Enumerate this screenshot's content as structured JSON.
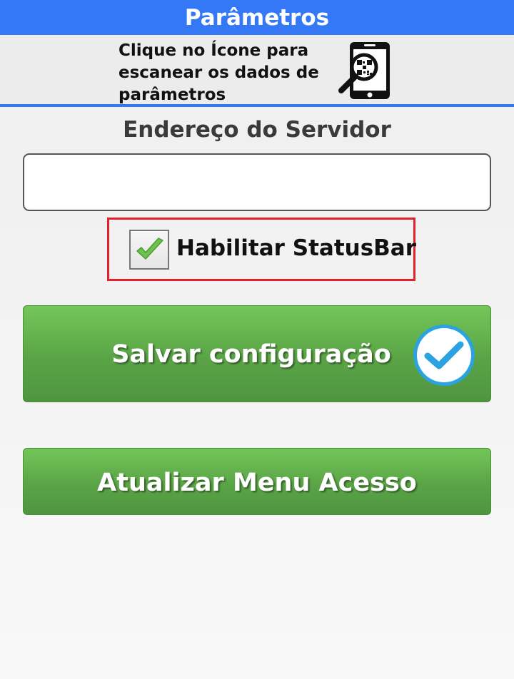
{
  "header": {
    "title": "Parâmetros"
  },
  "scan": {
    "instruction_line1": "Clique no Ícone para",
    "instruction_line2": "escanear os dados de",
    "instruction_line3": "parâmetros",
    "icon": "qr-scan-phone-icon"
  },
  "server": {
    "label": "Endereço do Servidor",
    "value": "",
    "placeholder": ""
  },
  "statusbar": {
    "label": "Habilitar StatusBar",
    "checked": true,
    "highlight_color": "#e0202a"
  },
  "buttons": {
    "save_label": "Salvar configuração",
    "save_icon": "check-circle-icon",
    "update_label": "Atualizar Menu Acesso"
  },
  "colors": {
    "header": "#3478f6",
    "button_green": "#5aa446",
    "check_blue": "#2aa3e0"
  }
}
